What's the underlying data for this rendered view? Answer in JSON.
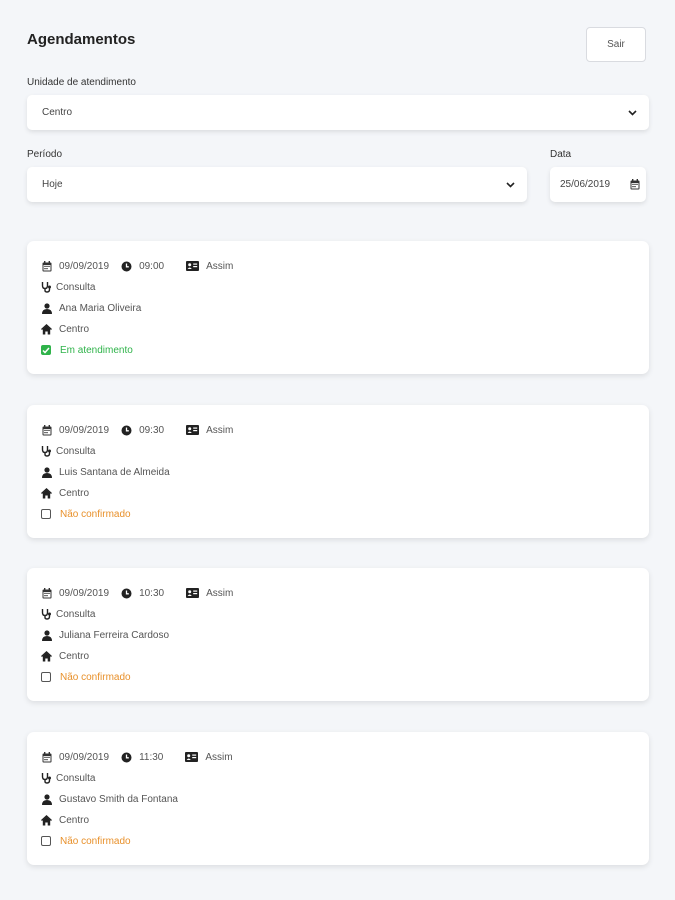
{
  "header": {
    "title": "Agendamentos",
    "logout_label": "Sair"
  },
  "filters": {
    "unit_label": "Unidade de atendimento",
    "unit_value": "Centro",
    "period_label": "Período",
    "period_value": "Hoje",
    "date_label": "Data",
    "date_value": "25/06/2019"
  },
  "colors": {
    "confirmed": "#2fb34a",
    "pending": "#e8902a",
    "background": "#f4f6f9"
  },
  "appointments": [
    {
      "date": "09/09/2019",
      "time": "09:00",
      "type": "Assim",
      "service": "Consulta",
      "patient": "Ana Maria Oliveira",
      "unit": "Centro",
      "status": "Em atendimento",
      "checked": true
    },
    {
      "date": "09/09/2019",
      "time": "09:30",
      "type": "Assim",
      "service": "Consulta",
      "patient": "Luis Santana de Almeida",
      "unit": "Centro",
      "status": "Não confirmado",
      "checked": false
    },
    {
      "date": "09/09/2019",
      "time": "10:30",
      "type": "Assim",
      "service": "Consulta",
      "patient": "Juliana Ferreira Cardoso",
      "unit": "Centro",
      "status": "Não confirmado",
      "checked": false
    },
    {
      "date": "09/09/2019",
      "time": "11:30",
      "type": "Assim",
      "service": "Consulta",
      "patient": "Gustavo Smith da Fontana",
      "unit": "Centro",
      "status": "Não confirmado",
      "checked": false
    }
  ]
}
